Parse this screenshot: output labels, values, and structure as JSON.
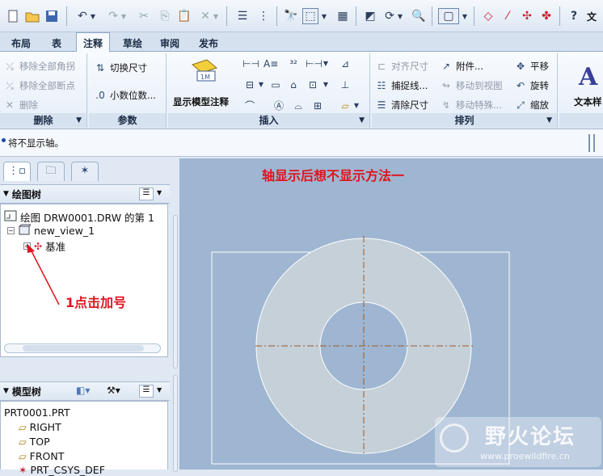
{
  "quick_access": {
    "right_label": "文"
  },
  "tabs": [
    {
      "label": "布局"
    },
    {
      "label": "表"
    },
    {
      "label": "注释",
      "active": true
    },
    {
      "label": "草绘"
    },
    {
      "label": "审阅"
    },
    {
      "label": "发布"
    }
  ],
  "ribbon": {
    "delete_group": {
      "title": "删除",
      "remove_all_angles": "移除全部角拐",
      "remove_all_breaks": "移除全部断点",
      "delete": "删除"
    },
    "params_group": {
      "title": "参数",
      "toggle_dim": "切换尺寸",
      "decimal_places": "小数位数..."
    },
    "insert_group": {
      "title": "插入",
      "show_model_annotations": "显示模型注释"
    },
    "arrange_group": {
      "title": "排列",
      "align_dims": "对齐尺寸",
      "attach": "附件...",
      "pan": "平移",
      "snap_lines": "捕捉线...",
      "move_to_view": "移动到视图",
      "rotate": "旋转",
      "clean_dims": "清除尺寸",
      "move_special": "移动特殊...",
      "scale": "缩放"
    },
    "text_group": {
      "text_style": "文本样"
    }
  },
  "message": "将不显示轴。",
  "left_panel": {
    "drawing_tree": {
      "title": "绘图树",
      "root": "绘图 DRW0001.DRW 的第 1",
      "view": "new_view_1",
      "datum": "基准"
    },
    "model_tree": {
      "title": "模型树",
      "root": "PRT0001.PRT",
      "items": [
        "RIGHT",
        "TOP",
        "FRONT",
        "PRT_CSYS_DEF"
      ]
    }
  },
  "canvas": {
    "heading": "轴显示后想不显示方法一",
    "annotation": "1点击加号",
    "heading_color": "#e0141e",
    "watermark_title": "野火论坛",
    "watermark_url": "www.proewildfire.cn"
  }
}
